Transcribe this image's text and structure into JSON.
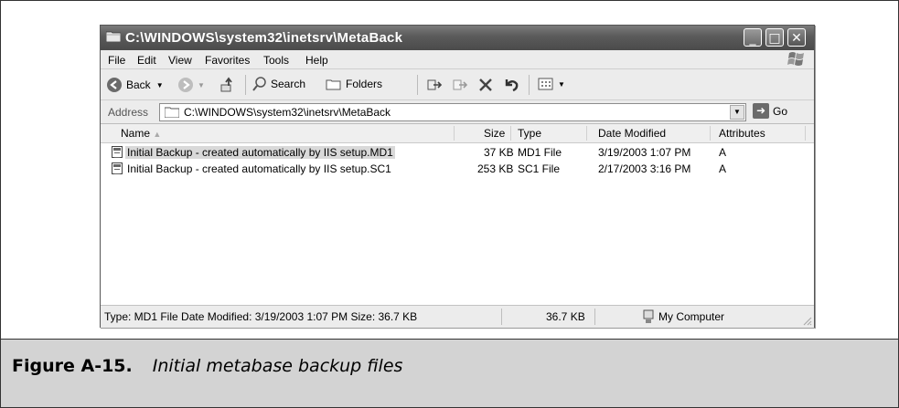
{
  "window": {
    "title": "C:\\WINDOWS\\system32\\inetsrv\\MetaBack",
    "minimize_glyph": "_",
    "maximize_glyph": "□",
    "close_glyph": "✕"
  },
  "menu": {
    "items": [
      {
        "label": "File"
      },
      {
        "label": "Edit"
      },
      {
        "label": "View"
      },
      {
        "label": "Favorites"
      },
      {
        "label": "Tools"
      },
      {
        "label": "Help"
      }
    ]
  },
  "toolbar": {
    "back_label": "Back",
    "search_label": "Search",
    "folders_label": "Folders"
  },
  "address": {
    "label": "Address",
    "value": "C:\\WINDOWS\\system32\\inetsrv\\MetaBack",
    "go_label": "Go"
  },
  "list": {
    "columns": [
      {
        "label": "Name"
      },
      {
        "label": "Size"
      },
      {
        "label": "Type"
      },
      {
        "label": "Date Modified"
      },
      {
        "label": "Attributes"
      }
    ],
    "rows": [
      {
        "name": "Initial Backup - created automatically by IIS setup.MD1",
        "size": "37 KB",
        "type": "MD1 File",
        "date": "3/19/2003 1:07 PM",
        "attributes": "A",
        "selected": true
      },
      {
        "name": "Initial Backup - created automatically by IIS setup.SC1",
        "size": "253 KB",
        "type": "SC1 File",
        "date": "2/17/2003 3:16 PM",
        "attributes": "A",
        "selected": false
      }
    ]
  },
  "status": {
    "details": "Type: MD1 File Date Modified: 3/19/2003 1:07 PM Size: 36.7 KB",
    "size": "36.7 KB",
    "location": "My Computer"
  },
  "caption": {
    "number": "Figure A-15.",
    "text": "Initial metabase backup files"
  },
  "icons": [
    "folder-icon",
    "windows-logo-icon",
    "back-arrow-icon",
    "forward-arrow-icon",
    "up-folder-icon",
    "search-icon",
    "folders-icon",
    "move-to-icon",
    "copy-to-icon",
    "delete-icon",
    "undo-icon",
    "views-icon",
    "file-icon",
    "computer-icon"
  ]
}
